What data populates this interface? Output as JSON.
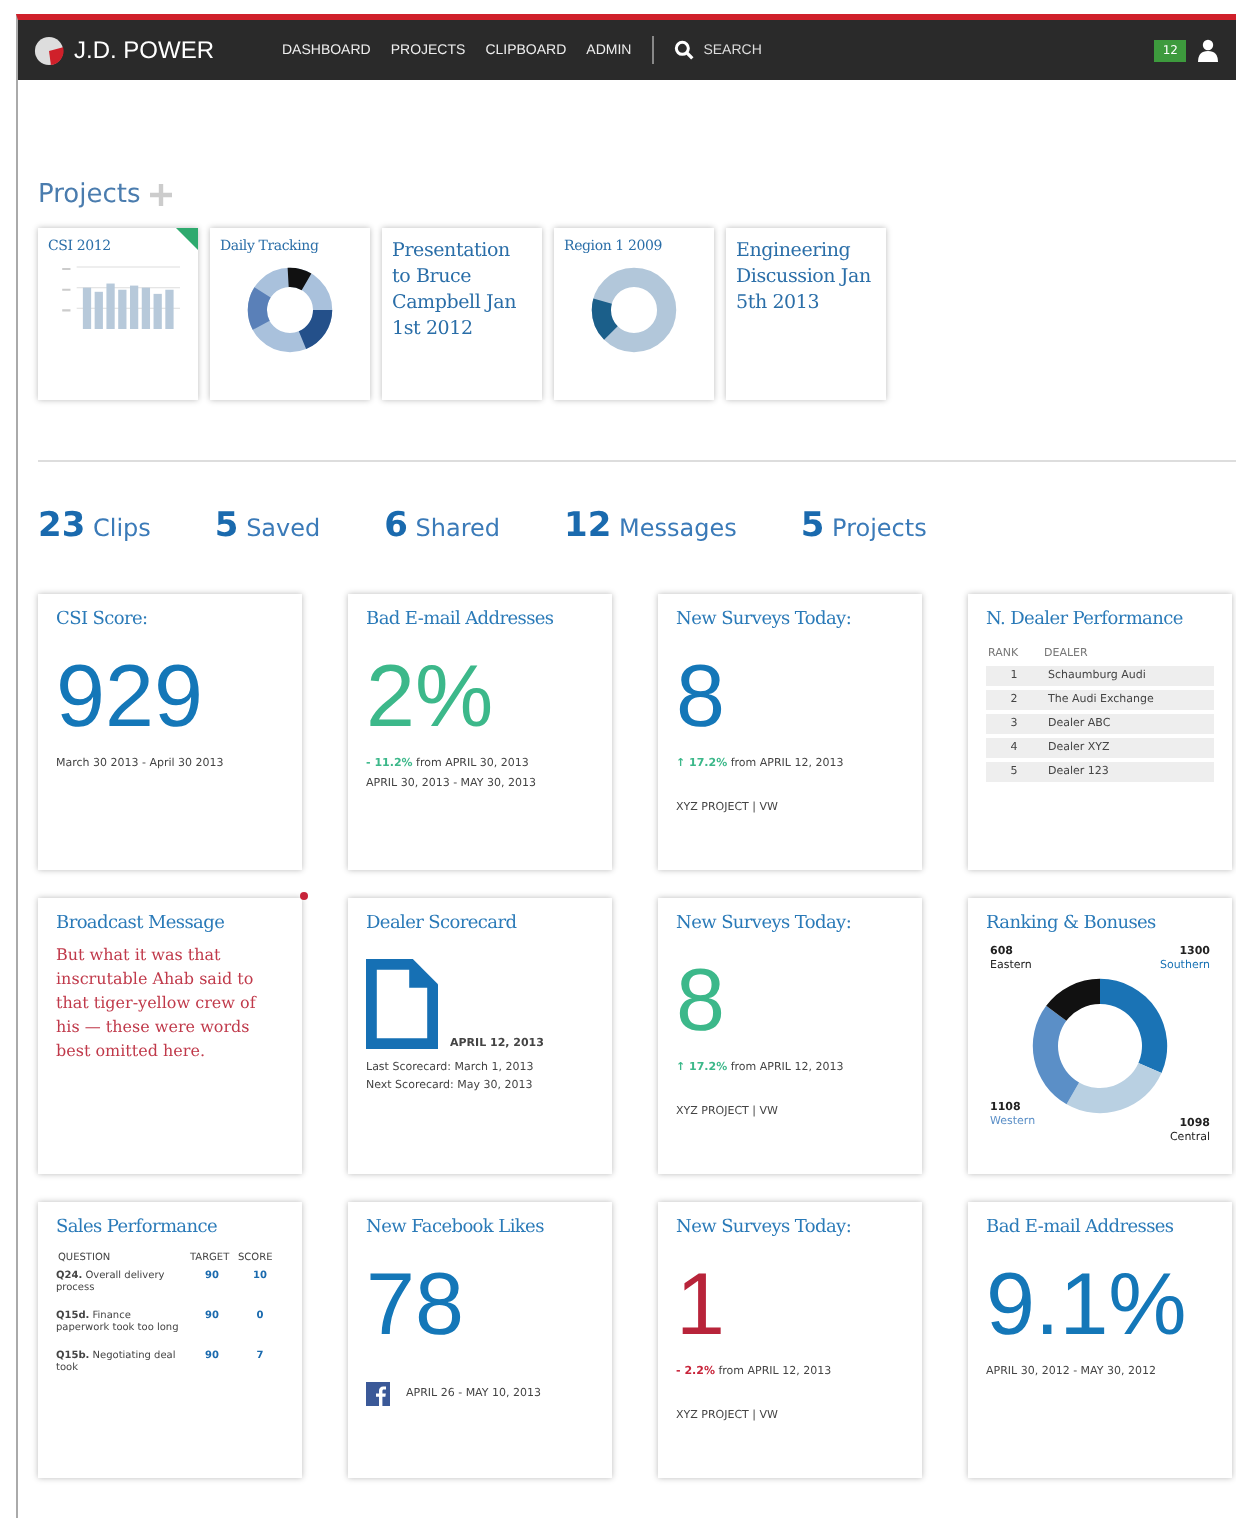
{
  "nav": {
    "brand": "J.D. POWER",
    "links": [
      "DASHBOARD",
      "PROJECTS",
      "CLIPBOARD",
      "ADMIN"
    ],
    "search": "SEARCH",
    "badge": "12"
  },
  "projects": {
    "title": "Projects",
    "tiles": [
      {
        "kind": "bars",
        "title": "CSI 2012",
        "flagged": true
      },
      {
        "kind": "donut",
        "title": "Daily Tracking",
        "flagged": false
      },
      {
        "kind": "text",
        "title": "Presentation to Bruce Campbell Jan 1st 2012",
        "flagged": false
      },
      {
        "kind": "ring",
        "title": "Region 1 2009",
        "flagged": false
      },
      {
        "kind": "text",
        "title": "Engineering Discussion Jan 5th 2013",
        "flagged": false
      }
    ]
  },
  "stats": [
    {
      "count": "23",
      "label": "Clips"
    },
    {
      "count": "5",
      "label": "Saved"
    },
    {
      "count": "6",
      "label": "Shared"
    },
    {
      "count": "12",
      "label": "Messages"
    },
    {
      "count": "5",
      "label": "Projects"
    }
  ],
  "cards": [
    {
      "kind": "metric",
      "title": "CSI Score:",
      "value": "929",
      "color": "#1477b8",
      "lines": [
        "March 30 2013 - April 30 2013"
      ]
    },
    {
      "kind": "metric",
      "title": "Bad E-mail Addresses",
      "value": "2%",
      "color": "#3cb88a",
      "delta": "- 11.2%",
      "negative": false,
      "delta_text": "from APRIL 30, 2013",
      "lines": [
        "APRIL 30, 2013 - MAY 30, 2013"
      ]
    },
    {
      "kind": "metric",
      "title": "New Surveys Today:",
      "value": "8",
      "color": "#1477b8",
      "delta": "↑ 17.2%",
      "negative": false,
      "delta_text": "from APRIL 12, 2013",
      "footer": "XYZ PROJECT | VW"
    },
    {
      "kind": "table",
      "title": "N. Dealer Performance",
      "columns": [
        "RANK",
        "DEALER"
      ],
      "rows": [
        [
          "1",
          "Schaumburg Audi"
        ],
        [
          "2",
          "The Audi Exchange"
        ],
        [
          "3",
          "Dealer ABC"
        ],
        [
          "4",
          "Dealer XYZ"
        ],
        [
          "5",
          "Dealer 123"
        ]
      ]
    },
    {
      "kind": "message",
      "title": "Broadcast Message",
      "text": "But what it was that inscrutable Ahab said to that tiger-yellow crew of his — these were words best omitted here.",
      "unread": true
    },
    {
      "kind": "scorecard",
      "title": "Dealer Scorecard",
      "date": "APRIL 12, 2013",
      "lines": [
        "Last Scorecard: March 1, 2013",
        "Next Scorecard: May 30, 2013"
      ]
    },
    {
      "kind": "metric",
      "title": "New Surveys Today:",
      "value": "8",
      "color": "#3cb88a",
      "delta": "↑ 17.2%",
      "negative": false,
      "delta_text": "from APRIL 12, 2013",
      "footer": "XYZ PROJECT | VW"
    },
    {
      "kind": "donut",
      "title": "Ranking & Bonuses",
      "chart_data": {
        "type": "donut",
        "categories": [
          "Southern",
          "Central",
          "Western",
          "Eastern"
        ],
        "series": [
          {
            "values": [
              1300,
              1098,
              1108,
              608
            ]
          }
        ],
        "colors": [
          "#1a73b5",
          "#b9d0e2",
          "#5b8fc7",
          "#111111"
        ],
        "data_labels": true
      }
    },
    {
      "kind": "sales",
      "title": "Sales Performance",
      "columns": [
        "QUESTION",
        "TARGET",
        "SCORE"
      ],
      "rows": [
        [
          "**Q24.** Overall delivery process",
          "90",
          "10"
        ],
        [
          "**Q15d.** Finance paperwork took too long",
          "90",
          "0"
        ],
        [
          "**Q15b.** Negotiating deal took",
          "90",
          "7"
        ]
      ]
    },
    {
      "kind": "facebook",
      "title": "New Facebook Likes",
      "value": "78",
      "color": "#1477b8",
      "date": "APRIL 26 - MAY 10, 2013"
    },
    {
      "kind": "metric",
      "title": "New Surveys Today:",
      "value": "1",
      "color": "#b8243a",
      "delta": "- 2.2%",
      "negative": true,
      "delta_text": "from APRIL 12, 2013",
      "footer": "XYZ PROJECT | VW"
    },
    {
      "kind": "metric",
      "title": "Bad E-mail Addresses",
      "value": "9.1%",
      "color": "#1477b8",
      "lines": [
        "APRIL 30, 2012 - MAY 30, 2012"
      ]
    }
  ]
}
